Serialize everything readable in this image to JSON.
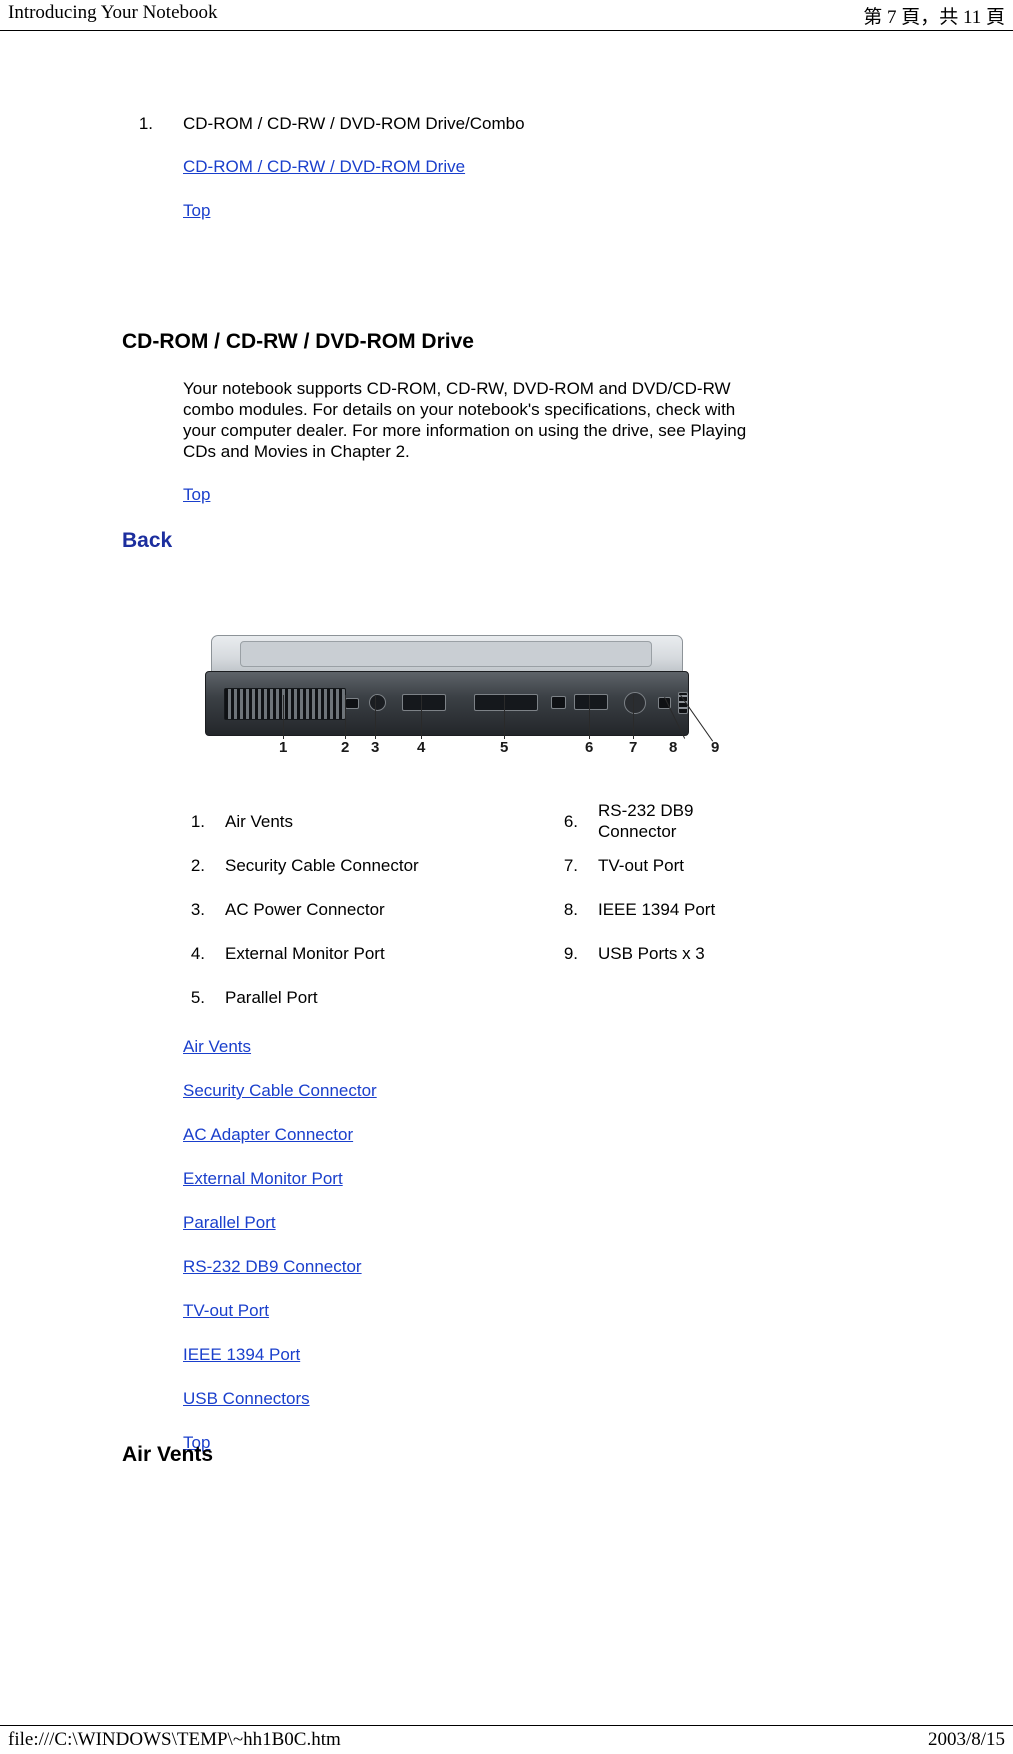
{
  "header": {
    "left_title": "Introducing Your Notebook",
    "right_pagination": "第 7 頁，共 11 頁"
  },
  "footer": {
    "file_path": "file:///C:\\WINDOWS\\TEMP\\~hh1B0C.htm",
    "date": "2003/8/15"
  },
  "top_list": {
    "number": "1.",
    "label": "CD-ROM / CD-RW / DVD-ROM Drive/Combo",
    "link": "CD-ROM / CD-RW / DVD-ROM Drive",
    "top_link": "Top"
  },
  "cdrom_section": {
    "heading": "CD-ROM / CD-RW / DVD-ROM Drive",
    "body": "Your notebook supports CD-ROM, CD-RW, DVD-ROM and DVD/CD-RW combo modules. For details on your notebook's specifications, check with your computer dealer. For more information on using the drive, see Playing CDs and Movies in Chapter 2.",
    "top_link": "Top"
  },
  "back_section": {
    "heading": "Back",
    "figure_caption_numbers": [
      "1",
      "2",
      "3",
      "4",
      "5",
      "6",
      "7",
      "8",
      "9"
    ],
    "items_left": [
      {
        "num": "1.",
        "label": "Air Vents"
      },
      {
        "num": "2.",
        "label": "Security Cable Connector"
      },
      {
        "num": "3.",
        "label": "AC Power Connector"
      },
      {
        "num": "4.",
        "label": "External Monitor Port"
      },
      {
        "num": "5.",
        "label": "Parallel Port"
      }
    ],
    "items_right": [
      {
        "num": "6.",
        "label": "RS-232 DB9 Connector"
      },
      {
        "num": "7.",
        "label": "TV-out Port"
      },
      {
        "num": "8.",
        "label": "IEEE 1394 Port"
      },
      {
        "num": "9.",
        "label": "USB Ports x 3"
      }
    ],
    "links": [
      "Air Vents",
      "Security Cable Connector",
      "AC Adapter Connector",
      "External Monitor Port",
      "Parallel Port",
      "RS-232 DB9 Connector",
      "TV-out Port",
      "IEEE 1394 Port",
      "USB Connectors",
      "Top"
    ]
  },
  "air_vents_section": {
    "heading": "Air Vents"
  },
  "colors": {
    "link": "#1a3fcc",
    "heading_blue": "#1c2e9e",
    "text": "#000000"
  }
}
